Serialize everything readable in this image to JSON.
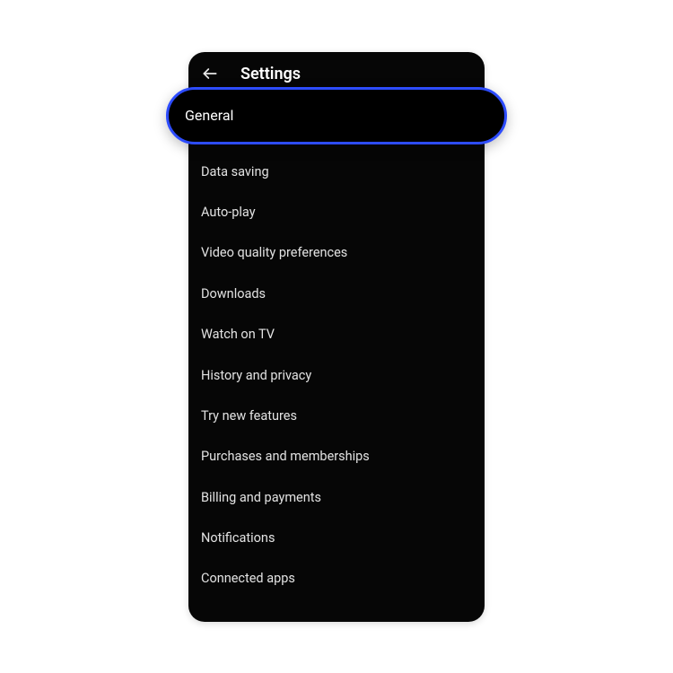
{
  "header": {
    "title": "Settings"
  },
  "selected": {
    "label": "General"
  },
  "menu": {
    "items": [
      {
        "label": "Data saving"
      },
      {
        "label": "Auto-play"
      },
      {
        "label": "Video quality preferences"
      },
      {
        "label": "Downloads"
      },
      {
        "label": "Watch on TV"
      },
      {
        "label": "History and privacy"
      },
      {
        "label": "Try new features"
      },
      {
        "label": "Purchases and memberships"
      },
      {
        "label": "Billing and payments"
      },
      {
        "label": "Notifications"
      },
      {
        "label": "Connected apps"
      }
    ]
  }
}
